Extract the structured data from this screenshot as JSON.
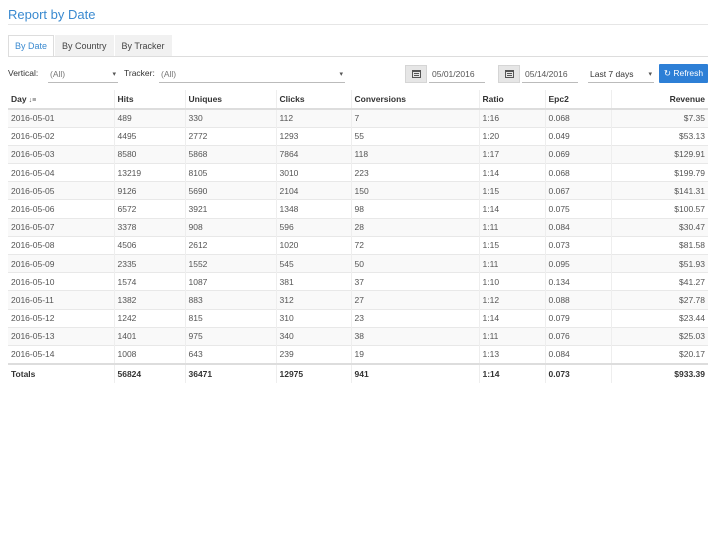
{
  "page": {
    "title": "Report by Date"
  },
  "tabs": [
    {
      "label": "By Date",
      "active": true
    },
    {
      "label": "By Country",
      "active": false
    },
    {
      "label": "By Tracker",
      "active": false
    }
  ],
  "filters": {
    "vertical_label": "Vertical:",
    "vertical_value": "(All)",
    "tracker_label": "Tracker:",
    "tracker_value": "(All)",
    "date_from": "05/01/2016",
    "date_to": "05/14/2016",
    "range_value": "Last 7 days",
    "refresh_label": "Refresh"
  },
  "table": {
    "columns": [
      "Day",
      "Hits",
      "Uniques",
      "Clicks",
      "Conversions",
      "Ratio",
      "Epc2",
      "Revenue"
    ],
    "rows": [
      [
        "2016-05-01",
        "489",
        "330",
        "112",
        "7",
        "1:16",
        "0.068",
        "$7.35"
      ],
      [
        "2016-05-02",
        "4495",
        "2772",
        "1293",
        "55",
        "1:20",
        "0.049",
        "$53.13"
      ],
      [
        "2016-05-03",
        "8580",
        "5868",
        "7864",
        "118",
        "1:17",
        "0.069",
        "$129.91"
      ],
      [
        "2016-05-04",
        "13219",
        "8105",
        "3010",
        "223",
        "1:14",
        "0.068",
        "$199.79"
      ],
      [
        "2016-05-05",
        "9126",
        "5690",
        "2104",
        "150",
        "1:15",
        "0.067",
        "$141.31"
      ],
      [
        "2016-05-06",
        "6572",
        "3921",
        "1348",
        "98",
        "1:14",
        "0.075",
        "$100.57"
      ],
      [
        "2016-05-07",
        "3378",
        "908",
        "596",
        "28",
        "1:11",
        "0.084",
        "$30.47"
      ],
      [
        "2016-05-08",
        "4506",
        "2612",
        "1020",
        "72",
        "1:15",
        "0.073",
        "$81.58"
      ],
      [
        "2016-05-09",
        "2335",
        "1552",
        "545",
        "50",
        "1:11",
        "0.095",
        "$51.93"
      ],
      [
        "2016-05-10",
        "1574",
        "1087",
        "381",
        "37",
        "1:10",
        "0.134",
        "$41.27"
      ],
      [
        "2016-05-11",
        "1382",
        "883",
        "312",
        "27",
        "1:12",
        "0.088",
        "$27.78"
      ],
      [
        "2016-05-12",
        "1242",
        "815",
        "310",
        "23",
        "1:14",
        "0.079",
        "$23.44"
      ],
      [
        "2016-05-13",
        "1401",
        "975",
        "340",
        "38",
        "1:11",
        "0.076",
        "$25.03"
      ],
      [
        "2016-05-14",
        "1008",
        "643",
        "239",
        "19",
        "1:13",
        "0.084",
        "$20.17"
      ]
    ],
    "totals": [
      "Totals",
      "56824",
      "36471",
      "12975",
      "941",
      "1:14",
      "0.073",
      "$933.39"
    ]
  }
}
